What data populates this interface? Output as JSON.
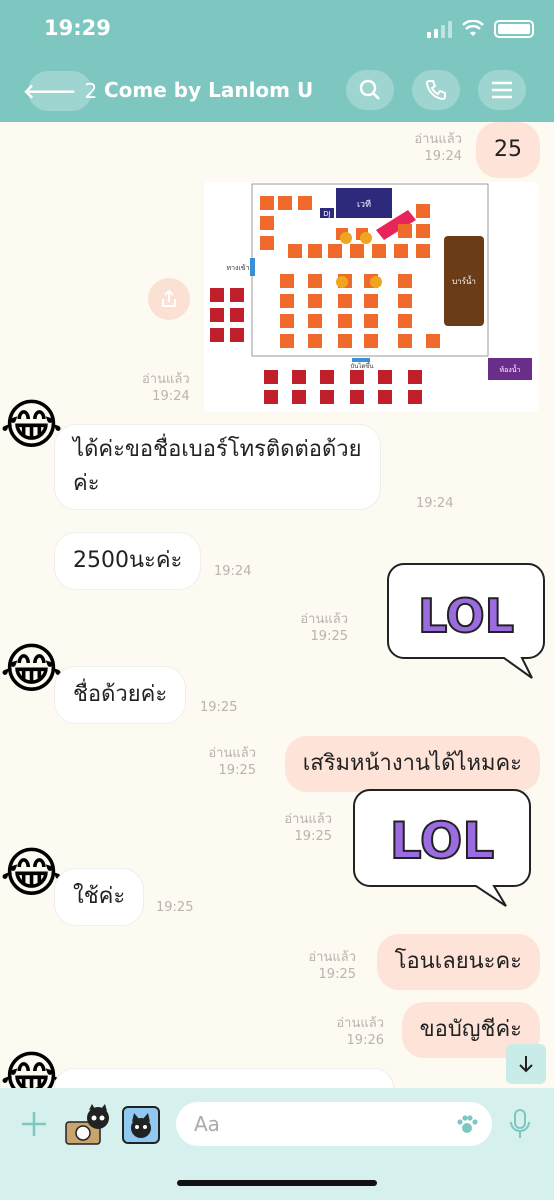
{
  "status": {
    "time": "19:29"
  },
  "header": {
    "back_count": "2",
    "title": "Come by Lanlom U"
  },
  "seatmap_labels": {
    "stage": "เวที",
    "dj": "DJ",
    "entrance": "ทางเข้า",
    "bar": "บาร์น้ำ",
    "restroom": "ห้องน้ำ",
    "staircase": "บันไดขึ้น"
  },
  "messages": [
    {
      "read": "อ่านแล้ว",
      "time": "19:24",
      "text": "25"
    },
    {
      "read": "อ่านแล้ว",
      "time": "19:24"
    },
    {
      "text_line1": "ได้ค่ะขอชื่อเบอร์โทรติดต่อด้วย",
      "text_line2": "ค่ะ",
      "time": "19:24"
    },
    {
      "text": "2500นะค่ะ",
      "time": "19:24"
    },
    {
      "read": "อ่านแล้ว",
      "time": "19:25",
      "sticker": "LOL"
    },
    {
      "text": "ชื่อด้วยค่ะ",
      "time": "19:25"
    },
    {
      "read": "อ่านแล้ว",
      "time": "19:25",
      "text": "เสริมหน้างานได้ไหมคะ"
    },
    {
      "read": "อ่านแล้ว",
      "time": "19:25",
      "sticker": "LOL"
    },
    {
      "text": "ใช้ค่ะ",
      "time": "19:25"
    },
    {
      "read": "อ่านแล้ว",
      "time": "19:25",
      "text": "โอนเลยนะคะ"
    },
    {
      "read": "อ่านแล้ว",
      "time": "19:26",
      "text": "ขอบัญชีค่ะ"
    }
  ],
  "input": {
    "placeholder": "Aa"
  }
}
